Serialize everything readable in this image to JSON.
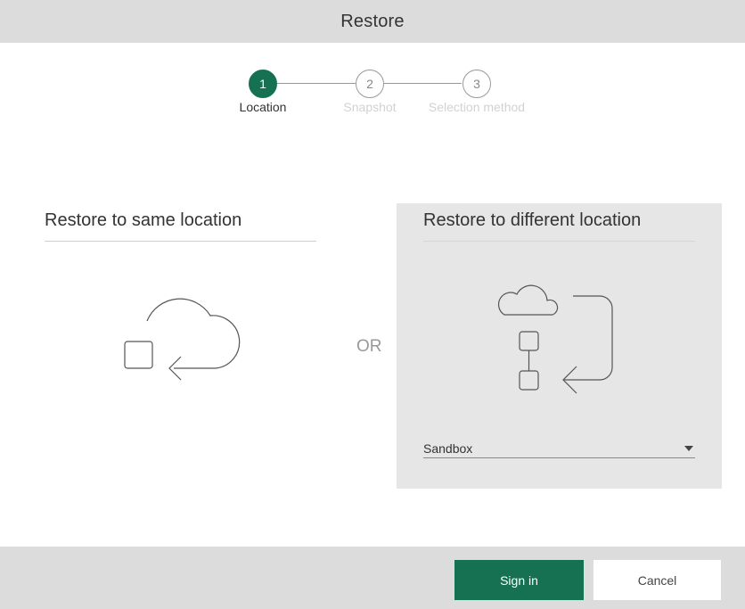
{
  "header": {
    "title": "Restore"
  },
  "stepper": {
    "steps": [
      {
        "number": "1",
        "label": "Location",
        "state": "active"
      },
      {
        "number": "2",
        "label": "Snapshot",
        "state": "inactive"
      },
      {
        "number": "3",
        "label": "Selection method",
        "state": "inactive"
      }
    ]
  },
  "options": {
    "same_location": {
      "title": "Restore to same location",
      "icon": "cloud-restore-icon"
    },
    "separator": "OR",
    "different_location": {
      "title": "Restore to different location",
      "icon": "cloud-transfer-icon",
      "select": {
        "value": "Sandbox"
      }
    }
  },
  "footer": {
    "primary_label": "Sign in",
    "secondary_label": "Cancel"
  },
  "colors": {
    "accent": "#157152",
    "header_bg": "#dcdcdc",
    "panel_selected_bg": "#e6e6e6"
  }
}
